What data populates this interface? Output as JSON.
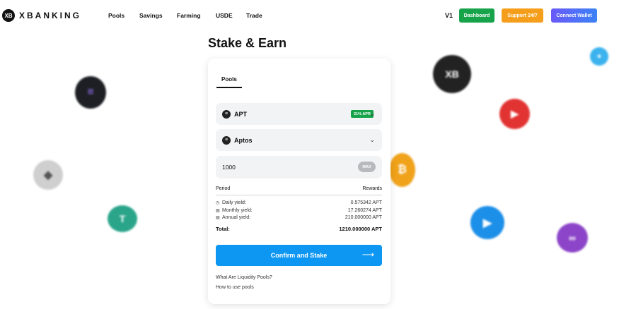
{
  "brand": {
    "logo_mark": "XB",
    "name": "XBANKING"
  },
  "nav": {
    "pools": "Pools",
    "savings": "Savings",
    "farming": "Farming",
    "usde": "USDE",
    "trade": "Trade"
  },
  "header": {
    "version": "V1",
    "dashboard": "Dashboard",
    "support": "Support 24/7",
    "connect": "Connect Wallet"
  },
  "page": {
    "title": "Stake & Earn"
  },
  "card": {
    "tab": "Pools",
    "asset": {
      "name": "APT",
      "apr_badge": "21% APR",
      "icon": "aptos-coin-icon"
    },
    "chain": {
      "name": "Aptos",
      "icon": "aptos-chain-icon"
    },
    "amount": {
      "value": "1000",
      "max_label": "MAX"
    },
    "period_label": "Period",
    "rewards_label": "Rewards",
    "yields": [
      {
        "label": "Daily yield:",
        "value": "0.575342 APT",
        "icon": "clock-icon"
      },
      {
        "label": "Monthly yield:",
        "value": "17.260274 APT",
        "icon": "calendar-icon"
      },
      {
        "label": "Annual yield:",
        "value": "210.000000 APT",
        "icon": "calendar-icon"
      }
    ],
    "total_label": "Total:",
    "total_value": "1210.000000 APT",
    "confirm_label": "Confirm and Stake",
    "links": [
      "What Are Liquidity Pools?",
      "How to use pools"
    ]
  },
  "colors": {
    "green": "#16a34a",
    "orange": "#f59e1b",
    "blue": "#0d96f2",
    "purple": "#6a5af9"
  }
}
